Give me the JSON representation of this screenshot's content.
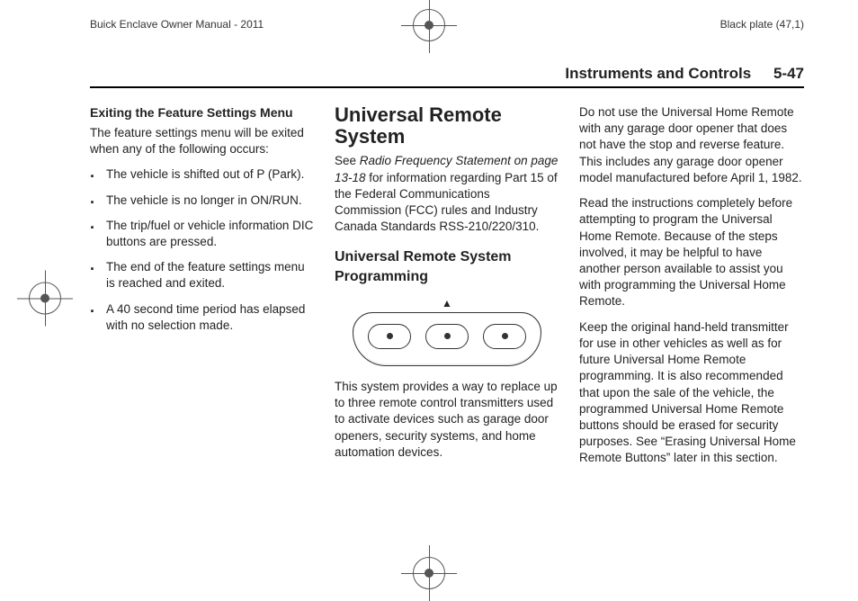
{
  "meta": {
    "manual_title": "Buick Enclave Owner Manual - 2011",
    "plate": "Black plate (47,1)"
  },
  "header": {
    "section_title": "Instruments and Controls",
    "page_num": "5-47"
  },
  "col1": {
    "heading": "Exiting the Feature Settings Menu",
    "intro": "The feature settings menu will be exited when any of the following occurs:",
    "bullets": [
      "The vehicle is shifted out of P (Park).",
      "The vehicle is no longer in ON/RUN.",
      "The trip/fuel or vehicle information DIC buttons are pressed.",
      "The end of the feature settings menu is reached and exited.",
      "A 40 second time period has elapsed with no selection made."
    ]
  },
  "col2": {
    "heading_main": "Universal Remote System",
    "para1_pre": "See ",
    "para1_ref": "Radio Frequency Statement on page 13‑18",
    "para1_post": " for information regarding Part 15 of the Federal Communications Commission (FCC) rules and Industry Canada Standards RSS-210/220/310.",
    "heading_sub": "Universal Remote System Programming",
    "indicator": "▲",
    "para2": "This system provides a way to replace up to three remote control transmitters used to activate devices such as garage door openers, security systems, and home automation devices."
  },
  "col3": {
    "para1": "Do not use the Universal Home Remote with any garage door opener that does not have the stop and reverse feature. This includes any garage door opener model manufactured before April 1, 1982.",
    "para2": "Read the instructions completely before attempting to program the Universal Home Remote. Because of the steps involved, it may be helpful to have another person available to assist you with programming the Universal Home Remote.",
    "para3": "Keep the original hand-held transmitter for use in other vehicles as well as for future Universal Home Remote programming. It is also recommended that upon the sale of the vehicle, the programmed Universal Home Remote buttons should be erased for security purposes. See “Erasing Universal Home Remote Buttons” later in this section."
  }
}
